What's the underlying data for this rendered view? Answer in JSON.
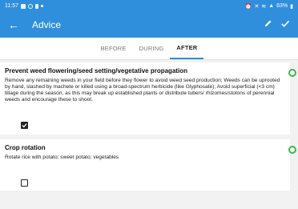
{
  "status": {
    "time": "11:57",
    "battery": "63%"
  },
  "appbar": {
    "title": "Advice"
  },
  "tabs": [
    {
      "label": "BEFORE",
      "active": false
    },
    {
      "label": "DURING",
      "active": false
    },
    {
      "label": "AFTER",
      "active": true
    }
  ],
  "cards": [
    {
      "title": "Prevent weed flowering/seed setting/vegetative propagation",
      "body": "Remove any remaining weeds in your field before they flower to avoid weed seed production; Weeds can be uprooted by hand, slashed by machete or killed using a broad-spectrum herbicide (like Glyphosate); Avoid superficial (<3 cm) tillage during the season, as this may break up established plants or distribute tubers/ rhizomes/stolons of perennial weeds and encourage these to shoot.",
      "checked": true
    },
    {
      "title": "Crop rotation",
      "body": "Rotate rice with potato; sweet potato; vegetables",
      "checked": false
    }
  ],
  "colors": {
    "primary": "#2f8fdc",
    "indicator": "#3bb84a"
  }
}
